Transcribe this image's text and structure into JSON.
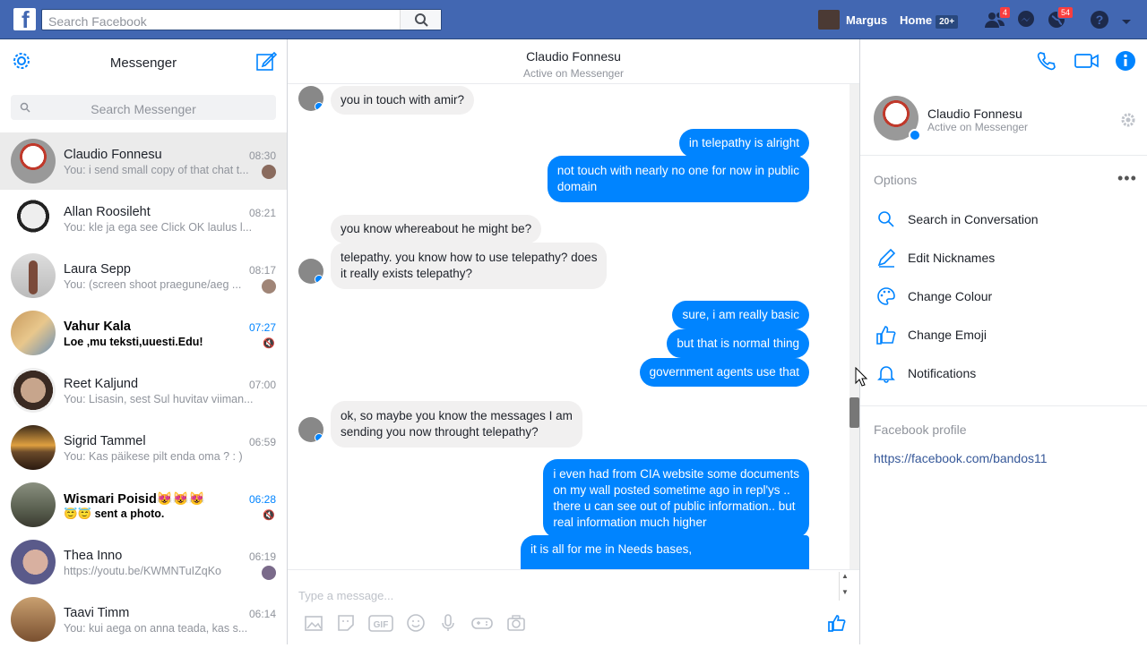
{
  "topbar": {
    "search_placeholder": "Search Facebook",
    "user_name": "Margus",
    "home_label": "Home",
    "home_count": "20+",
    "friend_requests_badge": "4",
    "notifications_badge": "54",
    "colors": {
      "bar": "#4267b2",
      "badge": "#fa3e3e"
    }
  },
  "left": {
    "title": "Messenger",
    "search_placeholder": "Search Messenger",
    "conversations": [
      {
        "name": "Claudio Fonnesu",
        "time": "08:30",
        "snippet": "You: i send small copy of that chat t...",
        "active": true,
        "unread": false
      },
      {
        "name": "Allan Roosileht",
        "time": "08:21",
        "snippet": "You: kle ja ega see Click OK laulus l...",
        "active": false,
        "unread": false
      },
      {
        "name": "Laura Sepp",
        "time": "08:17",
        "snippet": "You: (screen shoot praegune/aeg ...",
        "active": false,
        "unread": false
      },
      {
        "name": "Vahur Kala",
        "time": "07:27",
        "snippet": "Loe ,mu teksti,uuesti.Edu!",
        "active": false,
        "unread": true
      },
      {
        "name": "Reet Kaljund",
        "time": "07:00",
        "snippet": "You: Lisasin, sest Sul huvitav viiman...",
        "active": false,
        "unread": false
      },
      {
        "name": "Sigrid Tammel",
        "time": "06:59",
        "snippet": "You: Kas päikese pilt enda oma ? : )",
        "active": false,
        "unread": false
      },
      {
        "name": "Wismari Poisid😻😻😻",
        "time": "06:28",
        "snippet": "😇😇 sent a photo.",
        "active": false,
        "unread": true
      },
      {
        "name": "Thea Inno",
        "time": "06:19",
        "snippet": "https://youtu.be/KWMNTuIZqKo",
        "active": false,
        "unread": false
      },
      {
        "name": "Taavi Timm",
        "time": "06:14",
        "snippet": "You: kui aega on anna teada, kas s...",
        "active": false,
        "unread": false
      }
    ]
  },
  "chat": {
    "name": "Claudio Fonnesu",
    "status": "Active on Messenger",
    "messages": [
      {
        "dir": "in",
        "lines": [
          "you in touch with amir?"
        ]
      },
      {
        "dir": "out",
        "lines": [
          "in telepathy is alright"
        ]
      },
      {
        "dir": "out",
        "lines": [
          "not touch with nearly no one for now in public",
          "domain"
        ]
      },
      {
        "dir": "in",
        "lines": [
          "you know whereabout he might be?"
        ]
      },
      {
        "dir": "in",
        "lines": [
          "telepathy. you know how to use telepathy? does",
          "it really exists telepathy?"
        ]
      },
      {
        "dir": "out",
        "lines": [
          "sure, i am really basic"
        ]
      },
      {
        "dir": "out",
        "lines": [
          "but that is normal thing"
        ]
      },
      {
        "dir": "out",
        "lines": [
          "government agents use that"
        ]
      },
      {
        "dir": "in",
        "lines": [
          "ok, so maybe you know the messages I am",
          "sending you now throught telepathy?"
        ]
      },
      {
        "dir": "out",
        "lines": [
          "i even had from CIA website some documents",
          "on my wall posted sometime ago in repl'ys ..",
          "there u can see out of public information.. but",
          "real information much higher"
        ]
      },
      {
        "dir": "out",
        "lines": [
          "it is all for me in Needs bases,"
        ]
      }
    ],
    "composer_placeholder": "Type a message...",
    "colors": {
      "outgoing": "#0084ff",
      "incoming": "#f1f0f0"
    }
  },
  "info": {
    "name": "Claudio Fonnesu",
    "status": "Active on Messenger",
    "options_title": "Options",
    "options": [
      {
        "label": "Search in Conversation",
        "icon": "search-icon"
      },
      {
        "label": "Edit Nicknames",
        "icon": "pencil-icon"
      },
      {
        "label": "Change Colour",
        "icon": "palette-icon"
      },
      {
        "label": "Change Emoji",
        "icon": "thumbs-up-icon"
      },
      {
        "label": "Notifications",
        "icon": "bell-icon"
      }
    ],
    "profile_title": "Facebook profile",
    "profile_link": "https://facebook.com/bandos11"
  }
}
